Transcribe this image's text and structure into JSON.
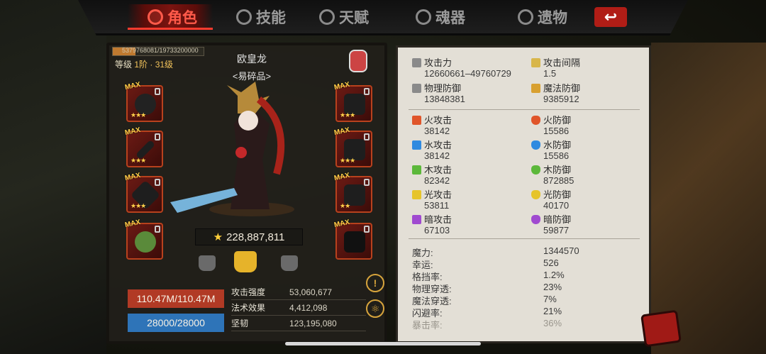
{
  "tabs": [
    {
      "label": "角色",
      "icon": "crown-icon",
      "active": true
    },
    {
      "label": "技能",
      "icon": "skill-icon",
      "active": false
    },
    {
      "label": "天赋",
      "icon": "talent-icon",
      "active": false
    },
    {
      "label": "魂器",
      "icon": "soul-icon",
      "active": false
    },
    {
      "label": "遗物",
      "icon": "relic-icon",
      "active": false
    }
  ],
  "back_label": "↩",
  "character": {
    "exp": "5379768081/19733200000",
    "level_prefix": "等级",
    "level_value": "1阶 · 31级",
    "name": "欧皇龙",
    "title": "<易碎品>",
    "power": "228,887,811",
    "hp": "110.47M/110.47M",
    "mp": "28000/28000"
  },
  "equip_badge": "MAX",
  "mini_stats": [
    {
      "label": "攻击强度",
      "value": "53,060,677"
    },
    {
      "label": "法术效果",
      "value": "4,412,098"
    },
    {
      "label": "坚韧",
      "value": "123,195,080"
    }
  ],
  "attributes": {
    "attack": {
      "label": "攻击力",
      "value": "12660661–49760729"
    },
    "interval": {
      "label": "攻击间隔",
      "value": "1.5"
    },
    "phys_def": {
      "label": "物理防御",
      "value": "13848381"
    },
    "magic_def": {
      "label": "魔法防御",
      "value": "9385912"
    },
    "fire_atk": {
      "label": "火攻击",
      "value": "38142"
    },
    "fire_def": {
      "label": "火防御",
      "value": "15586"
    },
    "water_atk": {
      "label": "水攻击",
      "value": "38142"
    },
    "water_def": {
      "label": "水防御",
      "value": "15586"
    },
    "wood_atk": {
      "label": "木攻击",
      "value": "82342"
    },
    "wood_def": {
      "label": "木防御",
      "value": "872885"
    },
    "light_atk": {
      "label": "光攻击",
      "value": "53811"
    },
    "light_def": {
      "label": "光防御",
      "value": "40170"
    },
    "dark_atk": {
      "label": "暗攻击",
      "value": "67103"
    },
    "dark_def": {
      "label": "暗防御",
      "value": "59877"
    }
  },
  "misc": [
    {
      "label": "魔力:",
      "value": "1344570"
    },
    {
      "label": "幸运:",
      "value": "526"
    },
    {
      "label": "格挡率:",
      "value": "1.2%"
    },
    {
      "label": "物理穿透:",
      "value": "23%"
    },
    {
      "label": "魔法穿透:",
      "value": "7%"
    },
    {
      "label": "闪避率:",
      "value": "21%"
    },
    {
      "label": "暴击率:",
      "value": "36%"
    }
  ],
  "colors": {
    "accent": "#ff5a4a",
    "hp": "#b13a25",
    "mp": "#2e74b8",
    "star": "#ffcf3a"
  }
}
